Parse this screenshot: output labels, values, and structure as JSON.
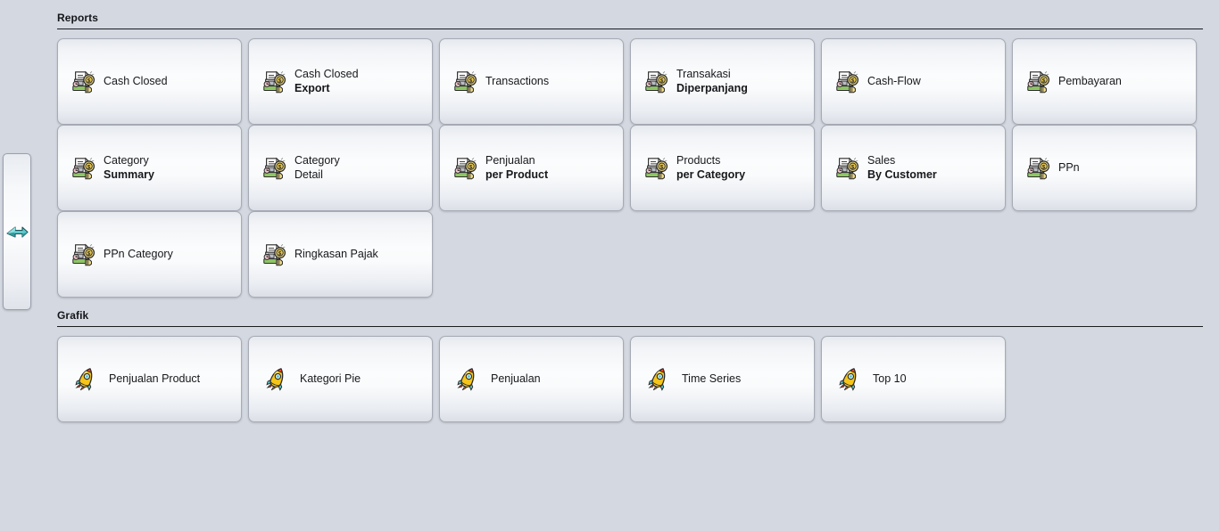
{
  "side_tab": {
    "icon": "double-arrow-right-icon",
    "accent_color": "#49c3c6"
  },
  "sections": [
    {
      "id": "reports",
      "title": "Reports",
      "icon": "report-coin-icon",
      "cards": [
        {
          "line1": "Cash Closed",
          "line2": ""
        },
        {
          "line1": "Cash Closed",
          "line2": "Export"
        },
        {
          "line1": "Transactions",
          "line2": ""
        },
        {
          "line1": "Transakasi",
          "line2": "Diperpanjang"
        },
        {
          "line1": "Cash-Flow",
          "line2": ""
        },
        {
          "line1": "Pembayaran",
          "line2": ""
        },
        {
          "line1": "Category",
          "line2": "Summary"
        },
        {
          "line1": "Category",
          "line2": "Detail",
          "line2_bold": false
        },
        {
          "line1": "Penjualan",
          "line2": "per Product"
        },
        {
          "line1": "Products",
          "line2": "per Category"
        },
        {
          "line1": "Sales",
          "line2": "By Customer"
        },
        {
          "line1": "PPn",
          "line2": ""
        },
        {
          "line1": "PPn Category",
          "line2": ""
        },
        {
          "line1": "Ringkasan Pajak",
          "line2": ""
        }
      ]
    },
    {
      "id": "grafik",
      "title": "Grafik",
      "icon": "rocket-icon",
      "cards": [
        {
          "line1": "Penjualan Product",
          "line2": ""
        },
        {
          "line1": "Kategori Pie",
          "line2": ""
        },
        {
          "line1": "Penjualan",
          "line2": ""
        },
        {
          "line1": "Time Series",
          "line2": ""
        },
        {
          "line1": "Top 10",
          "line2": ""
        }
      ]
    }
  ],
  "colors": {
    "background": "#d4d8e0",
    "card_border": "#a6abb5",
    "rule": "#1a1c20",
    "text": "#16181c",
    "rocket_body": "#f5c518",
    "rocket_fin": "#57c4c4",
    "coin": "#f2e07a"
  }
}
